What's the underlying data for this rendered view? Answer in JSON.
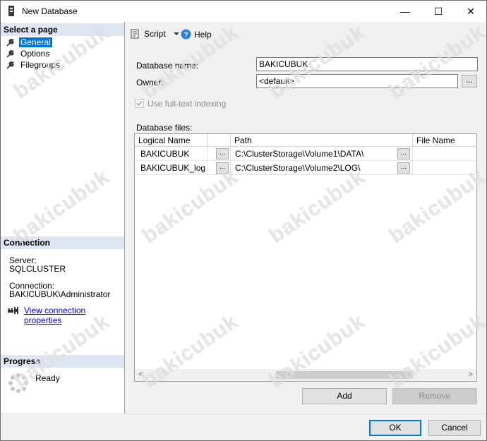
{
  "window": {
    "title": "New Database",
    "minimize_glyph": "—",
    "maximize_glyph": "☐",
    "close_glyph": "✕"
  },
  "left_pane": {
    "select_page_header": "Select a page",
    "pages": [
      {
        "label": "General",
        "selected": true,
        "icon": "wrench-icon"
      },
      {
        "label": "Options",
        "selected": false,
        "icon": "wrench-icon"
      },
      {
        "label": "Filegroups",
        "selected": false,
        "icon": "wrench-icon"
      }
    ],
    "connection_header": "Connection",
    "server_label": "Server:",
    "server_value": "SQLCLUSTER",
    "connection_label": "Connection:",
    "connection_value": "BAKICUBUK\\Administrator",
    "view_props_link": "View connection properties",
    "progress_header": "Progress",
    "progress_status": "Ready"
  },
  "toolbar": {
    "script_label": "Script",
    "help_label": "Help"
  },
  "general": {
    "db_name_label": "Database name:",
    "db_name_value": "BAKICUBUK",
    "owner_label": "Owner:",
    "owner_value": "<default>",
    "owner_browse": "...",
    "fulltext_label": "Use full-text indexing",
    "fulltext_checked": true,
    "db_files_label": "Database files:"
  },
  "grid": {
    "columns": [
      "Logical Name",
      "",
      "Path",
      "File Name"
    ],
    "rows": [
      {
        "logical_name": "BAKICUBUK",
        "btn1": "...",
        "path": "C:\\ClusterStorage\\Volume1\\DATA\\",
        "btn2": "..."
      },
      {
        "logical_name": "BAKICUBUK_log",
        "btn1": "...",
        "path": "C:\\ClusterStorage\\Volume2\\LOG\\",
        "btn2": "..."
      }
    ],
    "scroll_left": "<",
    "scroll_right": ">"
  },
  "buttons": {
    "add": "Add",
    "remove": "Remove",
    "ok": "OK",
    "cancel": "Cancel"
  },
  "watermark_text": "bakicubuk",
  "colors": {
    "selection": "#0078d7",
    "header_band": "#dde6f2",
    "link": "#0000ee"
  }
}
